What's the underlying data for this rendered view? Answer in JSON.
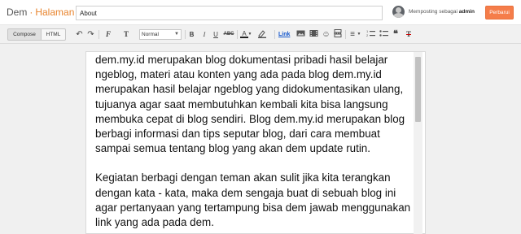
{
  "header": {
    "brand_blog": "Dem",
    "brand_sep": "·",
    "brand_page": "Halaman",
    "title_value": "About",
    "posting_as_label": "Memposting sebagai",
    "posting_user": "admin",
    "publish_label": "Perbarui"
  },
  "toolbar": {
    "mode_compose": "Compose",
    "mode_html": "HTML",
    "undo_icon": "↶",
    "redo_icon": "↷",
    "font_icon": "F",
    "font_size_icon": "T",
    "format_value": "Normal",
    "bold": "B",
    "italic": "I",
    "underline": "U",
    "strike": "ABC",
    "text_color": "A",
    "link": "Link",
    "emoji_icon": "☺",
    "align_icon": "≡",
    "numbered_icon": "⅟",
    "bullet_icon": "•",
    "quote_icon": "❝",
    "clear_format": "T"
  },
  "editor": {
    "paragraphs": [
      "dem.my.id merupakan blog dokumentasi pribadi hasil belajar ngeblog, materi atau konten yang ada pada blog dem.my.id merupakan hasil belajar ngeblog yang didokumentasikan ulang, tujuanya agar saat membutuhkan kembali kita bisa langsung membuka cepat di blog sendiri. Blog dem.my.id merupakan blog berbagi informasi dan tips seputar blog, dari cara membuat sampai semua tentang blog yang akan dem update rutin.",
      "Kegiatan berbagi dengan teman akan sulit jika kita terangkan dengan kata - kata, maka dem sengaja buat di sebuah blog ini agar pertanyaan yang tertampung bisa dem jawab menggunakan link yang ada pada dem."
    ]
  },
  "colors": {
    "accent": "#e8842d",
    "publish_bg": "#f57d4a",
    "link": "#1155cc"
  }
}
